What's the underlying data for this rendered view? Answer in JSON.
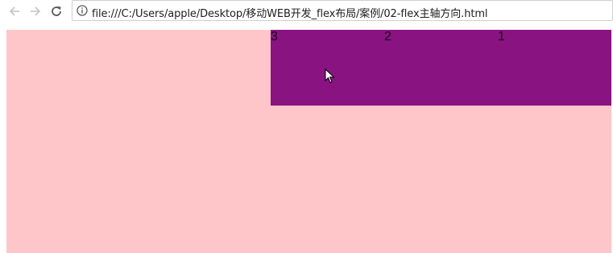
{
  "browser": {
    "back_icon": "arrow-left-icon",
    "forward_icon": "arrow-right-icon",
    "reload_icon": "reload-icon",
    "info_icon": "info-icon",
    "url": "file:///C:/Users/apple/Desktop/移动WEB开发_flex布局/案例/02-flex主轴方向.html"
  },
  "page": {
    "container_color": "#ffc6c9",
    "row_color": "#891381",
    "items": [
      "3",
      "2",
      "1"
    ]
  }
}
